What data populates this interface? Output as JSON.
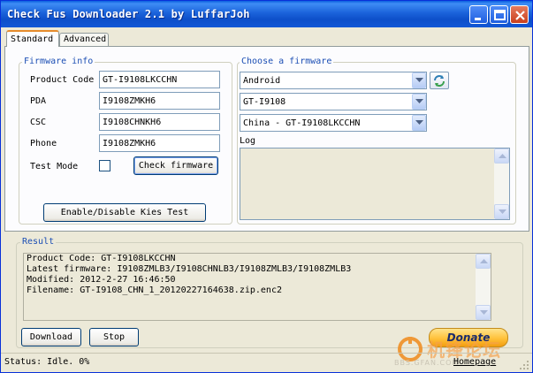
{
  "window": {
    "title": "Check Fus Downloader 2.1 by LuffarJoh"
  },
  "tabs": [
    {
      "label": "Standard",
      "active": true
    },
    {
      "label": "Advanced",
      "active": false
    }
  ],
  "firmware_info": {
    "group_label": "Firmware info",
    "fields": [
      {
        "label": "Product Code",
        "value": "GT-I9108LKCCHN"
      },
      {
        "label": "PDA",
        "value": "I9108ZMKH6"
      },
      {
        "label": "CSC",
        "value": "I9108CHNKH6"
      },
      {
        "label": "Phone",
        "value": "I9108ZMKH6"
      }
    ],
    "test_mode_label": "Test Mode",
    "test_mode_checked": false,
    "check_button": "Check firmware",
    "kies_button": "Enable/Disable Kies Test"
  },
  "choose_firmware": {
    "group_label": "Choose a firmware",
    "os_select": "Android",
    "model_select": "GT-I9108",
    "region_select": "China - GT-I9108LKCCHN",
    "log_label": "Log",
    "log_text": ""
  },
  "result": {
    "group_label": "Result",
    "lines": [
      "Product Code: GT-I9108LKCCHN",
      "Latest firmware: I9108ZMLB3/I9108CHNLB3/I9108ZMLB3/I9108ZMLB3",
      "Modified: 2012-2-27 16:46:50",
      "Filename: GT-I9108_CHN_1_20120227164638.zip.enc2"
    ]
  },
  "buttons": {
    "download": "Download",
    "stop": "Stop",
    "donate": "Donate"
  },
  "status": {
    "text": "Status: Idle. 0%",
    "homepage_link": "Homepage"
  },
  "watermark": {
    "main": "机锋论坛",
    "sub": "BBS.GFAN.COM"
  },
  "colors": {
    "titlebar": "#1B63DB",
    "group_label": "#1B4EB4",
    "tab_highlight": "#E68B2C",
    "donate": "#FFC13A",
    "watermark": "#F08A1C"
  }
}
